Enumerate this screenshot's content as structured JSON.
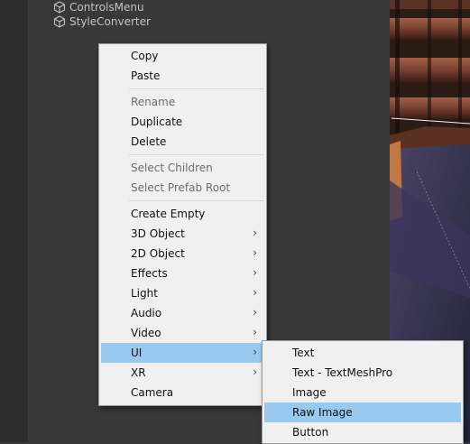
{
  "hierarchy": {
    "items": [
      "ControlsMenu",
      "StyleConverter"
    ]
  },
  "context_menu": {
    "copy": "Copy",
    "paste": "Paste",
    "rename": "Rename",
    "duplicate": "Duplicate",
    "delete": "Delete",
    "select_children": "Select Children",
    "select_prefab_root": "Select Prefab Root",
    "create_empty": "Create Empty",
    "object_3d": "3D Object",
    "object_2d": "2D Object",
    "effects": "Effects",
    "light": "Light",
    "audio": "Audio",
    "video": "Video",
    "ui": "UI",
    "xr": "XR",
    "camera": "Camera",
    "submenu_arrow": "›"
  },
  "ui_submenu": {
    "text": "Text",
    "text_tmp": "Text - TextMeshPro",
    "image": "Image",
    "raw_image": "Raw Image",
    "button": "Button"
  },
  "colors": {
    "menu_bg": "#f0f0f0",
    "highlight": "#99c9ef",
    "editor_bg": "#383838"
  }
}
